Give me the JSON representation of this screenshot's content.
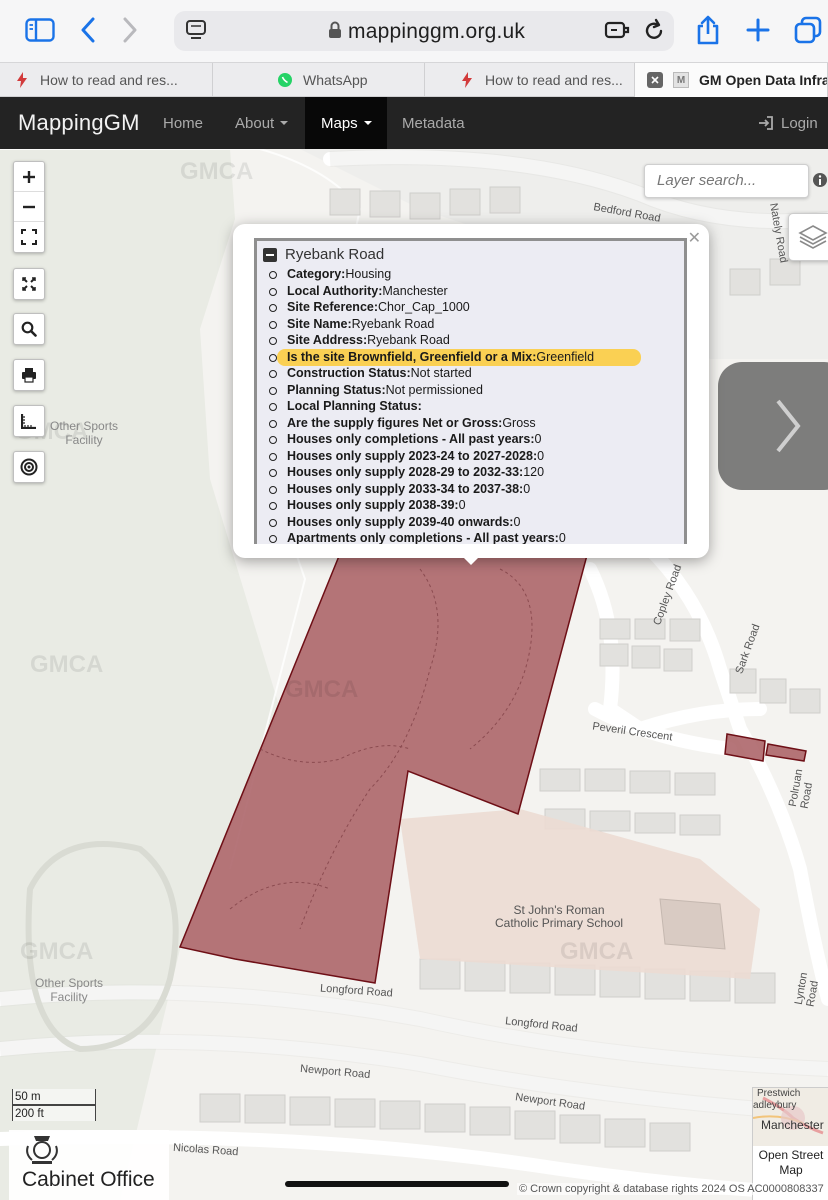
{
  "browser": {
    "url": "mappinggm.org.uk",
    "tabs": [
      {
        "label": "How to read and res..."
      },
      {
        "label": "WhatsApp"
      },
      {
        "label": "How to read and res..."
      },
      {
        "label": "GM Open Data Infra..."
      }
    ]
  },
  "navbar": {
    "brand": "MappingGM",
    "items": [
      {
        "label": "Home"
      },
      {
        "label": "About"
      },
      {
        "label": "Maps"
      },
      {
        "label": "Metadata"
      }
    ],
    "login": "Login"
  },
  "map": {
    "layer_search_placeholder": "Layer search...",
    "scale_metric": "50 m",
    "scale_imperial": "200 ft",
    "watermark": "GMCA",
    "labels": {
      "other_sports_1": "Other Sports\nFacility",
      "other_sports_2": "Other Sports\nFacility",
      "school": "St John's Roman\nCatholic Primary School",
      "longford_road_1": "Longford Road",
      "longford_road_2": "Longford Road",
      "newport_road_1": "Newport Road",
      "newport_road_2": "Newport Road",
      "nicolas_road": "Nicolas Road",
      "peveril_crescent": "Peveril Crescent",
      "copley_road": "Copley Road",
      "sark_road": "Sark Road",
      "polruan_road": "Polruan Road",
      "lynton_road": "Lynton Road",
      "bedford_road": "Bedford Road",
      "nately_road": "Nately Road"
    },
    "basemap_thumb": {
      "place_1": "Prestwich",
      "place_2": "adleybury",
      "place_3": "Manchester",
      "label": "Open Street Map"
    },
    "attribution": "© Crown copyright & database rights 2024 OS AC0000808337",
    "cabinet_office": "Cabinet Office",
    "site_fill_color": "#a85d62",
    "site_stroke_color": "#6e0f16"
  },
  "popup": {
    "title": "Ryebank Road",
    "attributes": [
      {
        "label": "Category:",
        "value": "Housing"
      },
      {
        "label": "Local Authority:",
        "value": "Manchester"
      },
      {
        "label": "Site Reference:",
        "value": "Chor_Cap_1000"
      },
      {
        "label": "Site Name:",
        "value": "Ryebank Road"
      },
      {
        "label": "Site Address:",
        "value": "Ryebank Road"
      },
      {
        "label": "Is the site Brownfield, Greenfield or a Mix:",
        "value": "Greenfield",
        "highlighted": true
      },
      {
        "label": "Construction Status:",
        "value": "Not started"
      },
      {
        "label": "Planning Status:",
        "value": "Not permissioned"
      },
      {
        "label": "Local Planning Status:",
        "value": ""
      },
      {
        "label": "Are the supply figures Net or Gross:",
        "value": "Gross"
      },
      {
        "label": "Houses only completions - All past years:",
        "value": "0"
      },
      {
        "label": "Houses only supply 2023-24 to 2027-2028:",
        "value": "0"
      },
      {
        "label": "Houses only supply 2028-29 to 2032-33:",
        "value": "120"
      },
      {
        "label": "Houses only supply 2033-34 to 2037-38:",
        "value": "0"
      },
      {
        "label": "Houses only supply 2038-39:",
        "value": "0"
      },
      {
        "label": "Houses only supply 2039-40 onwards:",
        "value": "0"
      },
      {
        "label": "Apartments only completions - All past years:",
        "value": "0"
      }
    ],
    "highlight_color": "#ffc71e"
  }
}
